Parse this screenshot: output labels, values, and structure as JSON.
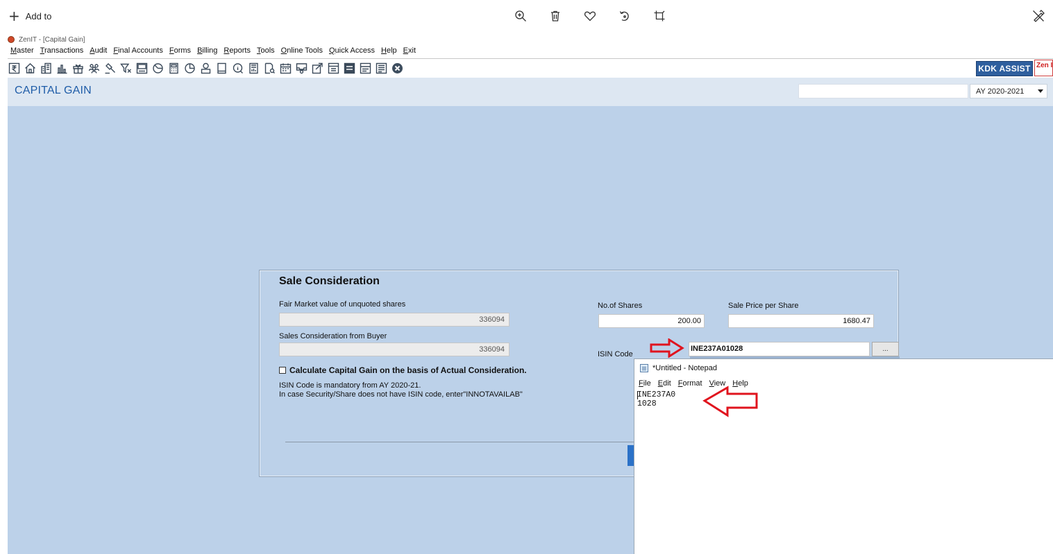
{
  "viewer": {
    "add_to_label": "Add to",
    "tools": [
      "zoom-in",
      "delete",
      "favorite",
      "rotate",
      "crop"
    ],
    "edit_tool": "edit"
  },
  "app": {
    "window_title": "ZenIT - [Capital Gain]",
    "menu": [
      "Master",
      "Transactions",
      "Audit",
      "Final Accounts",
      "Forms",
      "Billing",
      "Reports",
      "Tools",
      "Online Tools",
      "Quick Access",
      "Help",
      "Exit"
    ],
    "kdk_button": "KDK ASSIST",
    "zen_tab": "Zen I",
    "screen_title": "CAPITAL GAIN",
    "assessment_year": "AY 2020-2021"
  },
  "sale": {
    "title": "Sale Consideration",
    "fmv_label": "Fair Market value of unquoted shares",
    "fmv_value": "336094",
    "buyer_label": "Sales Consideration from Buyer",
    "buyer_value": "336094",
    "shares_label": "No.of Shares",
    "shares_value": "200.00",
    "price_label": "Sale Price per Share",
    "price_value": "1680.47",
    "isin_label": "ISIN Code",
    "isin_value": "INE237A01028",
    "browse_label": "...",
    "checkbox_label": "Calculate Capital Gain on the basis of Actual Consideration.",
    "note_line1": "ISIN Code is mandatory from AY 2020-21.",
    "note_line2": "In case Security/Share does not have ISIN code, enter\"INNOTAVAILAB\""
  },
  "notepad": {
    "title": "*Untitled - Notepad",
    "menu": [
      "File",
      "Edit",
      "Format",
      "View",
      "Help"
    ],
    "content": "INE237A0\n1028"
  },
  "colors": {
    "workspace": "#bcd1e9",
    "title_blue": "#1f5da8",
    "kdk_blue": "#2f5f9e",
    "arrow_red": "#e0141e"
  }
}
